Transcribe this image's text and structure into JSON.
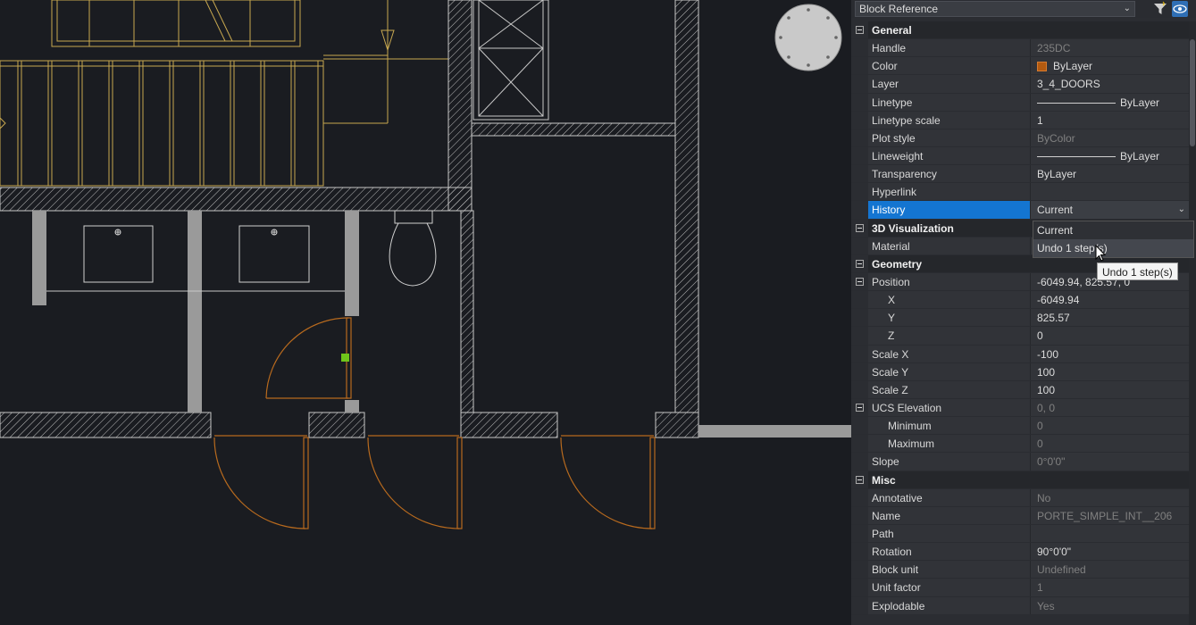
{
  "panel": {
    "selector_value": "Block Reference",
    "sections": [
      {
        "title": "General",
        "rows": [
          {
            "label": "Handle",
            "value": "235DC",
            "readonly": true
          },
          {
            "label": "Color",
            "value": "ByLayer",
            "swatch": "#b35a0f"
          },
          {
            "label": "Layer",
            "value": "3_4_DOORS"
          },
          {
            "label": "Linetype",
            "value": "ByLayer",
            "line": true
          },
          {
            "label": "Linetype scale",
            "value": "1"
          },
          {
            "label": "Plot style",
            "value": "ByColor",
            "readonly": true
          },
          {
            "label": "Lineweight",
            "value": "ByLayer",
            "line": true
          },
          {
            "label": "Transparency",
            "value": "ByLayer"
          },
          {
            "label": "Hyperlink",
            "value": ""
          },
          {
            "label": "History",
            "value": "Current",
            "selected": true,
            "dropdown": true
          }
        ]
      },
      {
        "title": "3D Visualization",
        "rows": [
          {
            "label": "Material",
            "value": ""
          }
        ]
      },
      {
        "title": "Geometry",
        "rows": [
          {
            "label": "Position",
            "value": "-6049.94, 825.57, 0",
            "collapsible": true
          },
          {
            "label": "X",
            "value": "-6049.94",
            "indent": 2
          },
          {
            "label": "Y",
            "value": "825.57",
            "indent": 2
          },
          {
            "label": "Z",
            "value": "0",
            "indent": 2
          },
          {
            "label": "Scale X",
            "value": "-100"
          },
          {
            "label": "Scale Y",
            "value": "100"
          },
          {
            "label": "Scale Z",
            "value": "100"
          },
          {
            "label": "UCS Elevation",
            "value": "0, 0",
            "readonly": true,
            "collapsible": true
          },
          {
            "label": "Minimum",
            "value": "0",
            "readonly": true,
            "indent": 1
          },
          {
            "label": "Maximum",
            "value": "0",
            "readonly": true,
            "indent": 1
          },
          {
            "label": "Slope",
            "value": "0°0'0\"",
            "readonly": true
          }
        ]
      },
      {
        "title": "Misc",
        "rows": [
          {
            "label": "Annotative",
            "value": "No",
            "readonly": true
          },
          {
            "label": "Name",
            "value": "PORTE_SIMPLE_INT__206",
            "readonly": true
          },
          {
            "label": "Path",
            "value": ""
          },
          {
            "label": "Rotation",
            "value": "90°0'0\""
          },
          {
            "label": "Block unit",
            "value": "Undefined",
            "readonly": true
          },
          {
            "label": "Unit factor",
            "value": "1",
            "readonly": true
          },
          {
            "label": "Explodable",
            "value": "Yes",
            "readonly": true
          }
        ]
      }
    ],
    "history_dropdown": {
      "options": [
        "Current",
        "Undo 1 step(s)"
      ],
      "hovered": "Undo 1 step(s)"
    },
    "tooltip": "Undo 1 step(s)"
  },
  "colors": {
    "walls": "#c8c8c8",
    "stairs": "#c8a850",
    "doors": "#b86a1e",
    "grip": "#6fc61a",
    "selected_row": "#1475d1"
  }
}
